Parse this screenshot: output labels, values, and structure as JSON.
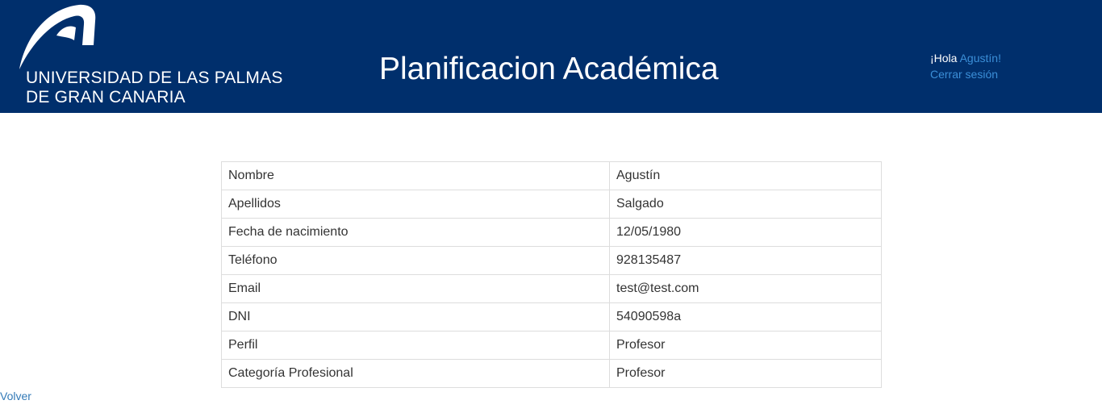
{
  "header": {
    "logo_text_line1": "UNIVERSIDAD DE LAS PALMAS",
    "logo_text_line2": "DE GRAN CANARIA",
    "title": "Planificacion Académica",
    "background_color": "#002f6c"
  },
  "user": {
    "greeting_prefix": "¡Hola ",
    "name": "Agustín",
    "greeting_suffix": "!",
    "logout_label": "Cerrar sesión"
  },
  "profile_table": {
    "rows": [
      {
        "label": "Nombre",
        "value": "Agustín"
      },
      {
        "label": "Apellidos",
        "value": "Salgado"
      },
      {
        "label": "Fecha de nacimiento",
        "value": "12/05/1980"
      },
      {
        "label": "Teléfono",
        "value": "928135487"
      },
      {
        "label": "Email",
        "value": "test@test.com"
      },
      {
        "label": "DNI",
        "value": "54090598a"
      },
      {
        "label": "Perfil",
        "value": "Profesor"
      },
      {
        "label": "Categoría Profesional",
        "value": "Profesor"
      }
    ]
  },
  "footer": {
    "back_label": "Volver"
  },
  "colors": {
    "link": "#337ab7",
    "header_link": "#3b8fd8"
  }
}
